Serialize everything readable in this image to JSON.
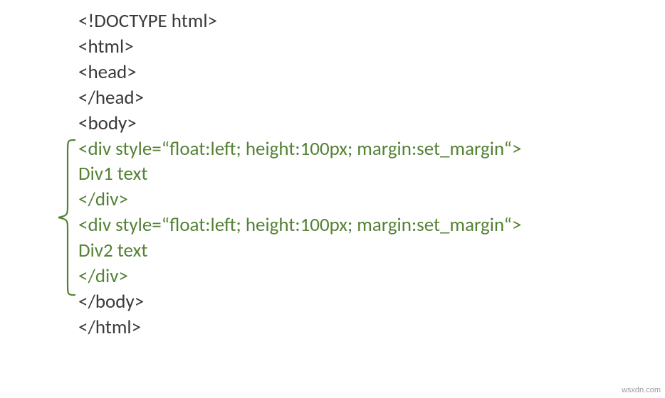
{
  "code": {
    "l1": "<!DOCTYPE html>",
    "l2": "<html>",
    "l3": "<head>",
    "l4": "</head>",
    "l5": "<body>",
    "l6": "<div style=“float:left; height:100px; margin:set_margin“>",
    "l7": "Div1 text",
    "l8": "</div>",
    "l9": "<div style=“float:left; height:100px; margin:set_margin“>",
    "l10": "Div2 text",
    "l11": "</div>",
    "l12": "</body>",
    "l13": "</html>"
  },
  "watermark": "wsxdn.com",
  "colors": {
    "black": "#3a3a3a",
    "green": "#548235"
  }
}
